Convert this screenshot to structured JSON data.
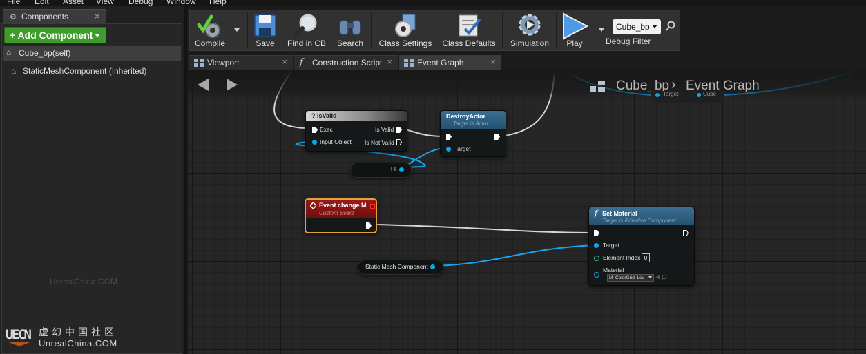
{
  "menu": [
    "File",
    "Edit",
    "Asset",
    "View",
    "Debug",
    "Window",
    "Help"
  ],
  "components_panel": {
    "tab_title": "Components",
    "close_glyph": "×",
    "add_button": "+ Add Component",
    "self_item": "Cube_bp(self)",
    "child_item": "StaticMeshComponent (Inherited)"
  },
  "watermark": {
    "mid_text": "UnrealChina.COM",
    "logo_text": "UECN",
    "cn_text": "虚幻中国社区",
    "en_text": "UnrealChina.COM"
  },
  "toolbar": {
    "compile": "Compile",
    "save": "Save",
    "find_in_cb": "Find in CB",
    "search": "Search",
    "class_settings": "Class Settings",
    "class_defaults": "Class Defaults",
    "simulation": "Simulation",
    "play": "Play",
    "debug_object": "Cube_bp",
    "debug_filter": "Debug Filter"
  },
  "editor_tabs": [
    {
      "label": "Viewport"
    },
    {
      "label": "Construction Script"
    },
    {
      "label": "Event Graph"
    }
  ],
  "breadcrumb": {
    "class_name": "Cube_bp",
    "separator": "›",
    "graph_name": "Event Graph"
  },
  "nodes": {
    "top_partial": {
      "pin_target": "Target",
      "pin_cube": "Cube"
    },
    "isvalid": {
      "title": "? IsValid",
      "exec": "Exec",
      "is_valid": "Is Valid",
      "input_object": "Input Object",
      "is_not_valid": "Is Not Valid"
    },
    "destroy_actor": {
      "title": "DestroyActor",
      "subtitle": "Target is Actor",
      "target": "Target"
    },
    "ui_var": {
      "label": "Ui"
    },
    "event_change": {
      "title": "Event change M",
      "subtitle": "Custom Event"
    },
    "set_material": {
      "title": "Set Material",
      "subtitle": "Target is Primitive Component",
      "target": "Target",
      "element_index": "Element Index",
      "element_index_value": "0",
      "material": "Material",
      "material_value": "M_ColorGrid_Lov"
    },
    "static_mesh_var": {
      "label": "Static Mesh Component"
    }
  },
  "colors": {
    "add_button": "#3f9b2a",
    "object_pin": "#0ea5e9",
    "event_header": "#8b1111",
    "function_header": "#2b5c7b"
  }
}
